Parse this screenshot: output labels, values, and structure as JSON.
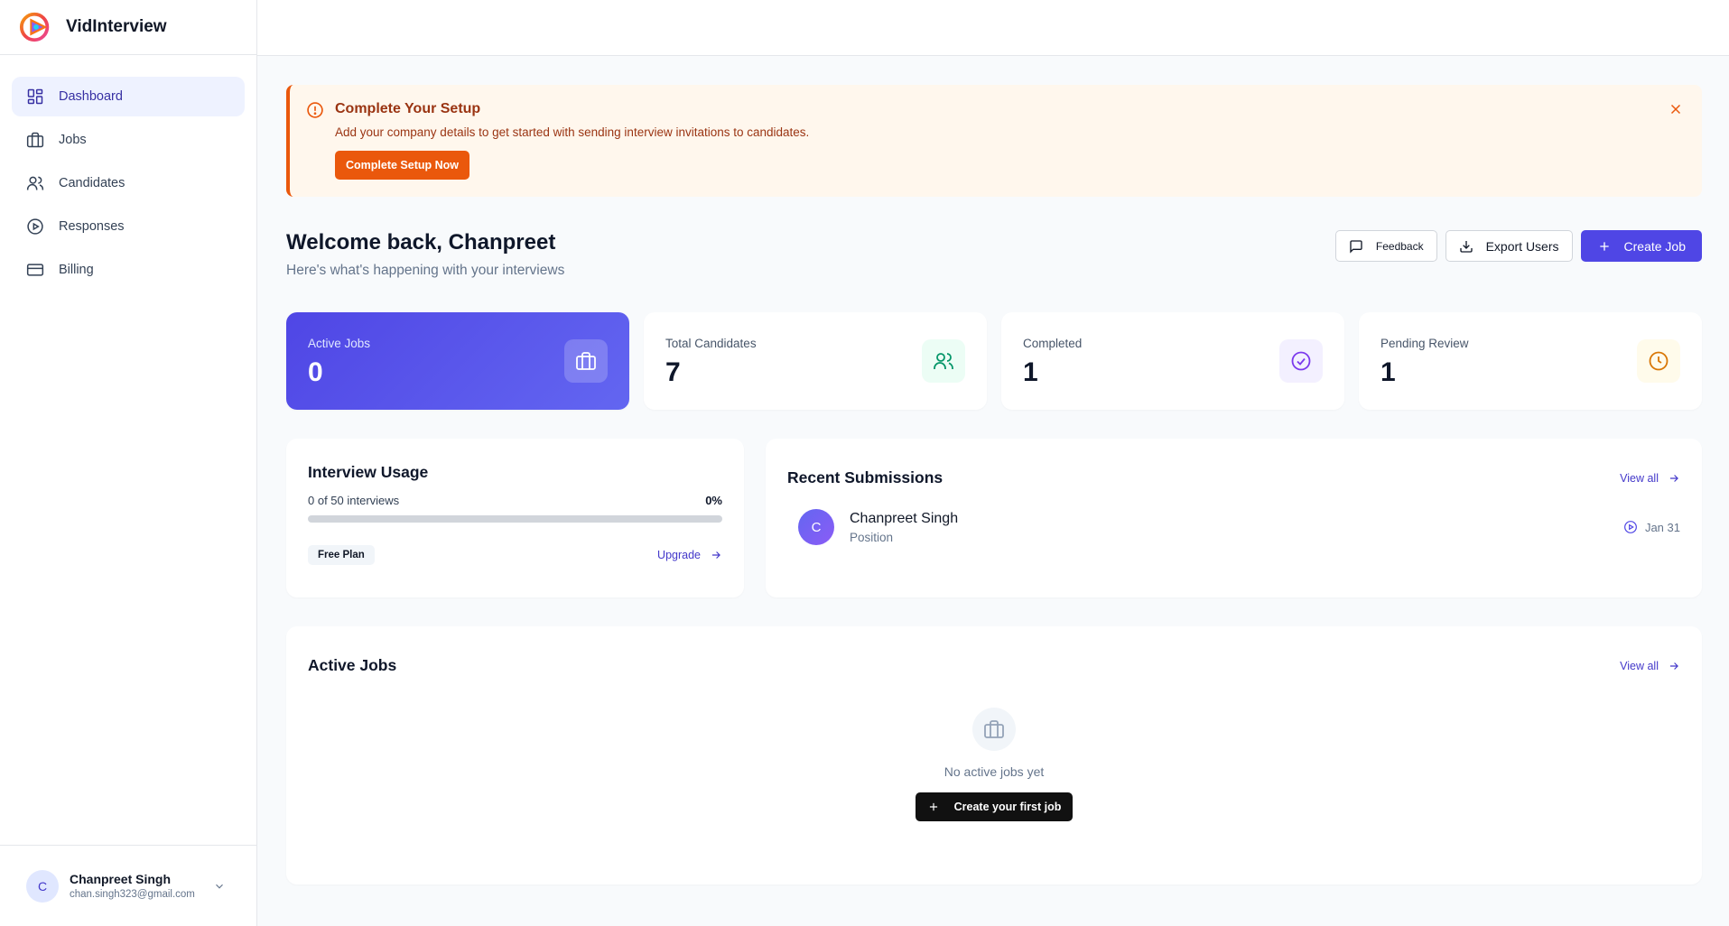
{
  "brand": {
    "name": "VidInterview"
  },
  "sidebar": {
    "items": [
      {
        "label": "Dashboard",
        "icon": "dashboard-icon",
        "active": true
      },
      {
        "label": "Jobs",
        "icon": "briefcase-icon"
      },
      {
        "label": "Candidates",
        "icon": "users-icon"
      },
      {
        "label": "Responses",
        "icon": "play-circle-icon"
      },
      {
        "label": "Billing",
        "icon": "credit-card-icon"
      }
    ]
  },
  "user": {
    "initial": "C",
    "name": "Chanpreet Singh",
    "email": "chan.singh323@gmail.com"
  },
  "alert": {
    "title": "Complete Your Setup",
    "text": "Add your company details to get started with sending interview invitations to candidates.",
    "button": "Complete Setup Now"
  },
  "welcome": {
    "title": "Welcome back, Chanpreet",
    "subtitle": "Here's what's happening with your interviews"
  },
  "actions": {
    "feedback": "Feedback",
    "export": "Export Users",
    "create": "Create Job"
  },
  "stats": [
    {
      "label": "Active Jobs",
      "value": "0",
      "icon": "briefcase-icon"
    },
    {
      "label": "Total Candidates",
      "value": "7",
      "icon": "users-icon"
    },
    {
      "label": "Completed",
      "value": "1",
      "icon": "check-circle-icon"
    },
    {
      "label": "Pending Review",
      "value": "1",
      "icon": "clock-icon"
    }
  ],
  "usage": {
    "title": "Interview Usage",
    "summary": "0 of 50 interviews",
    "percent_label": "0%",
    "progress_fraction": 0,
    "plan": "Free Plan",
    "upgrade": "Upgrade"
  },
  "recent": {
    "title": "Recent Submissions",
    "view_all": "View all",
    "items": [
      {
        "initial": "C",
        "name": "Chanpreet Singh",
        "position": "Position",
        "date": "Jan 31"
      }
    ]
  },
  "jobs": {
    "title": "Active Jobs",
    "view_all": "View all",
    "empty_text": "No active jobs yet",
    "empty_button": "Create your first job"
  },
  "colors": {
    "accent": "#4f46e5",
    "warning": "#ea580c",
    "success": "#059669"
  }
}
